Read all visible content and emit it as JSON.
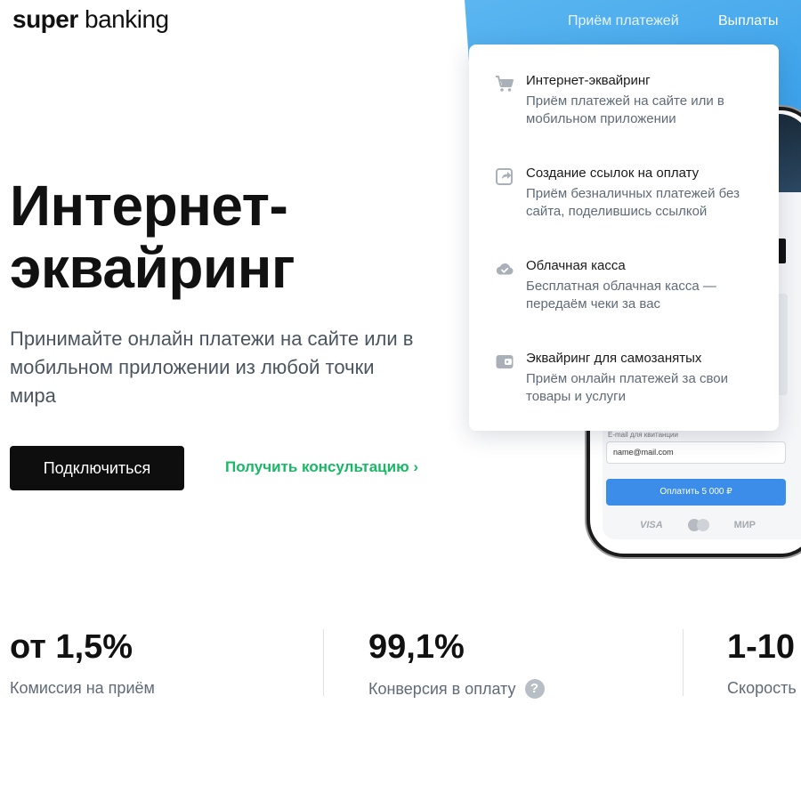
{
  "logo": {
    "part_bold": "super",
    "part_light": "banking"
  },
  "nav": {
    "receive_payments": "Приём платежей",
    "payouts": "Выплаты"
  },
  "dropdown": {
    "items": [
      {
        "icon": "cart-icon",
        "title": "Интернет-эквайринг",
        "description": "Приём платежей на сайте или в мобильном приложении"
      },
      {
        "icon": "share-link-icon",
        "title": "Создание ссылок на оплату",
        "description": "Приём безналичных платежей без сайта, поделившись ссылкой"
      },
      {
        "icon": "cloud-check-icon",
        "title": "Облачная касса",
        "description": "Бесплатная облачная касса — передаём чеки за вас"
      },
      {
        "icon": "wallet-icon",
        "title": "Эквайринг для самозанятых",
        "description": "Приём онлайн платежей за свои товары и услуги"
      }
    ]
  },
  "hero": {
    "title": "Интернет-эквайринг",
    "subtitle": "Принимайте онлайн платежи на сайте или в мобильном приложении из любой точки мира",
    "connect_button": "Подключиться",
    "consult_link": "Получить консультацию ›"
  },
  "phone": {
    "email_label": "E-mail для квитанции",
    "email_value": "name@mail.com",
    "pay_button": "Оплатить 5 000 ₽",
    "brands": {
      "visa": "VISA",
      "mir": "МИР"
    }
  },
  "stats": [
    {
      "value": "от 1,5%",
      "label": "Комиссия на приём"
    },
    {
      "value": "99,1%",
      "label": "Конверсия в оплату",
      "help": "?"
    },
    {
      "value": "1-10",
      "label": "Скорость"
    }
  ],
  "colors": {
    "accent_green": "#19b866",
    "hero_blue": "#3da2ea",
    "pay_button_blue": "#3b8de9",
    "primary_button": "#0e0e0e"
  }
}
